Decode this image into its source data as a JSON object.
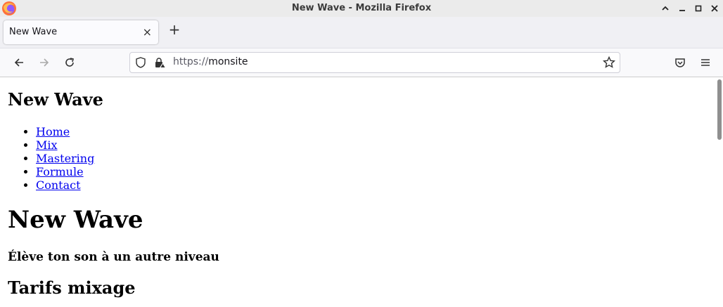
{
  "window": {
    "title": "New Wave - Mozilla Firefox"
  },
  "tabs": [
    {
      "label": "New Wave",
      "close": "×"
    }
  ],
  "newtab_label": "+",
  "urlbar": {
    "scheme": "https://",
    "host": "monsite"
  },
  "page": {
    "site_title": "New Wave",
    "nav": [
      "Home",
      "Mix",
      "Mastering",
      "Formule",
      "Contact"
    ],
    "hero_title": "New Wave",
    "tagline": "Élève ton son à un autre niveau",
    "section_title": "Tarifs mixage"
  },
  "colors": {
    "link": "#0000ee",
    "titlebar": "#ebebeb",
    "tabbar": "#f0f0f4"
  }
}
